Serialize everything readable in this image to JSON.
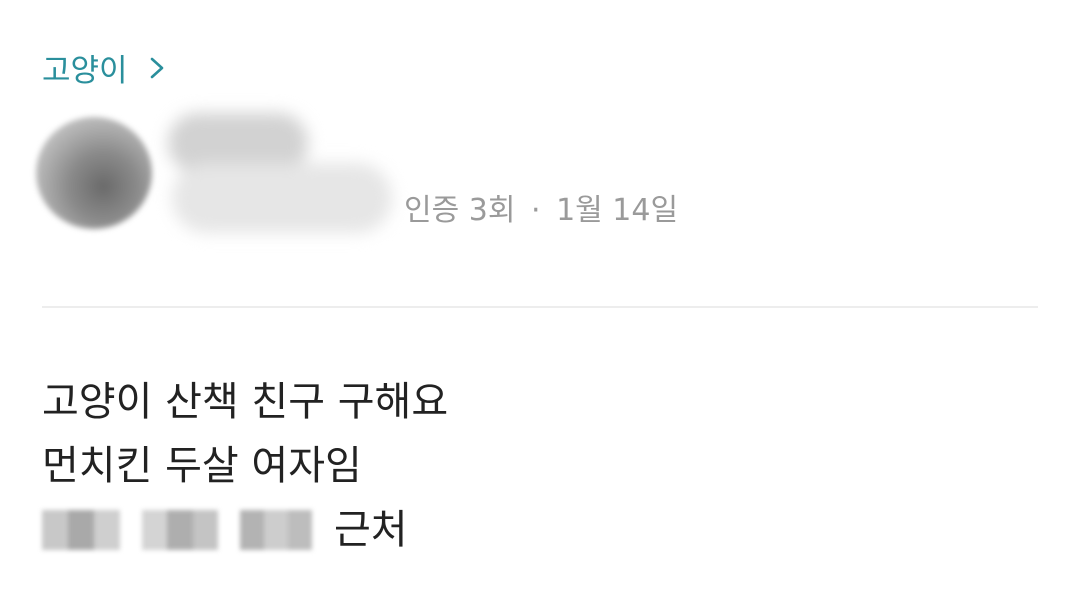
{
  "post": {
    "category": "고양이",
    "category_chevron_icon": "chevron-right-icon",
    "author": {
      "avatar_icon": "avatar",
      "meta_verify": "인증 3회",
      "meta_separator": "·",
      "meta_date": "1월 14일"
    },
    "content": {
      "line1": "고양이 산책 친구 구해요",
      "line2": "먼치킨 두살 여자임",
      "line3_suffix": "근처"
    }
  },
  "colors": {
    "category": "#2a8f9c",
    "meta": "#9a9a9a",
    "body_text": "#222222",
    "divider": "#ededed"
  }
}
